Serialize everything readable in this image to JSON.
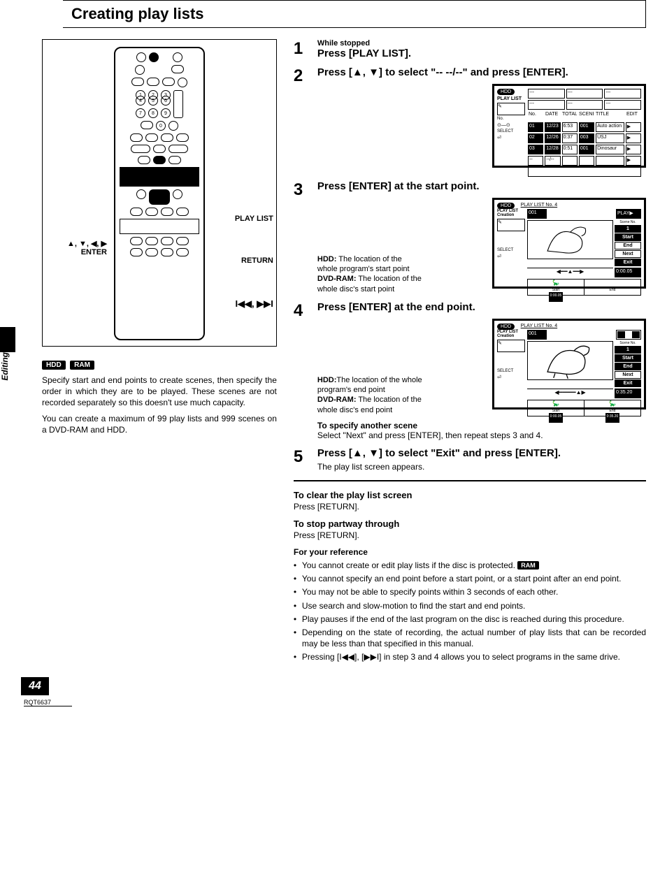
{
  "title": "Creating play lists",
  "side_tab": "Editing",
  "page_number": "44",
  "doc_code": "RQT6637",
  "remote_callouts": {
    "playlist": "PLAY LIST",
    "enter": "▲, ▼, ◀, ▶\nENTER",
    "return": "RETURN",
    "skip": "I◀◀, ▶▶I"
  },
  "badges": {
    "hdd": "HDD",
    "ram": "RAM"
  },
  "intro": {
    "p1": "Specify start and end points to create scenes, then specify the order in which they are to be played. These scenes are not recorded separately so this doesn't use much capacity.",
    "p2": "You can create a maximum of 99 play lists and 999 scenes on a DVD-RAM and HDD."
  },
  "steps": {
    "s1": {
      "pre": "While stopped",
      "main": "Press [PLAY LIST]."
    },
    "s2": {
      "main": "Press [▲, ▼] to select \"-- --/--\" and press [ENTER]."
    },
    "s3": {
      "main": "Press [ENTER] at the start point.",
      "note": {
        "l1": "HDD:",
        "l1b": " The location of the whole program's start point",
        "l2": "DVD-RAM:",
        "l2b": " The location of the whole disc's start point"
      }
    },
    "s4": {
      "main": "Press [ENTER] at the end point.",
      "note": {
        "l1": "HDD:",
        "l1b": "The location of the whole program's end point",
        "l2": "DVD-RAM:",
        "l2b": " The location of the whole disc's end point"
      }
    },
    "another": {
      "h": "To specify another scene",
      "p": "Select \"Next\" and press [ENTER], then repeat steps 3 and 4."
    },
    "s5": {
      "main": "Press [▲, ▼] to select \"Exit\" and press [ENTER].",
      "sub": "The play list screen appears."
    }
  },
  "aux": {
    "clear_h": "To clear the play list screen",
    "clear_p": "Press [RETURN].",
    "stop_h": "To stop partway through",
    "stop_p": "Press [RETURN]."
  },
  "ref": {
    "h": "For your reference",
    "items": [
      {
        "t": "You cannot create or edit play lists if the disc is protected. ",
        "badge": "RAM"
      },
      {
        "t": "You cannot specify an end point before a start point, or a start point after an end point."
      },
      {
        "t": "You may not be able to specify points within 3 seconds of each other."
      },
      {
        "t": "Use search and slow-motion to find the start and end points."
      },
      {
        "t": "Play pauses if the end of the last program on the disc is reached during this procedure."
      },
      {
        "t": "Depending on the state of recording, the actual number of play lists that can be recorded may be less than that specified in this manual."
      },
      {
        "t": "Pressing [I◀◀], [▶▶I] in step 3 and 4 allows you to select programs in the same drive."
      }
    ]
  },
  "screen1": {
    "hdd": "HDD",
    "label": "PLAY LIST",
    "cols": [
      "No.",
      "DATE",
      "TOTAL",
      "SCENE",
      "TITLE",
      "EDIT"
    ],
    "rows": [
      [
        "01",
        "12/23",
        "6:53",
        "001",
        "Auto action",
        "▶"
      ],
      [
        "02",
        "12/26",
        "0:37",
        "003",
        "USJ",
        "▶"
      ],
      [
        "03",
        "12/28",
        "0:51",
        "001",
        "Dinosaur",
        "▶"
      ],
      [
        "--",
        "--/--",
        "",
        "",
        "",
        "▶"
      ]
    ]
  },
  "screen3": {
    "head": "PLAY LIST No. 4",
    "label": "PLAY LIST\nCreation",
    "num": "001",
    "play": "PLAY▶",
    "scene": "Scene No.",
    "scene_n": "1",
    "menu": [
      "Start",
      "End",
      "Next",
      "Exit"
    ],
    "time_r": "0:00.05",
    "start": "Start",
    "end": "End",
    "time_l": "0:00.05"
  },
  "screen4": {
    "head": "PLAY LIST No. 4",
    "label": "PLAY LIST\nCreation",
    "num": "001",
    "scene": "Scene No.",
    "scene_n": "1",
    "menu": [
      "Start",
      "End",
      "Next",
      "Exit"
    ],
    "time_r": "0:35.20",
    "start": "Start",
    "end": "End",
    "time_l": "0:00.05",
    "time_l2": "0:35.20"
  }
}
